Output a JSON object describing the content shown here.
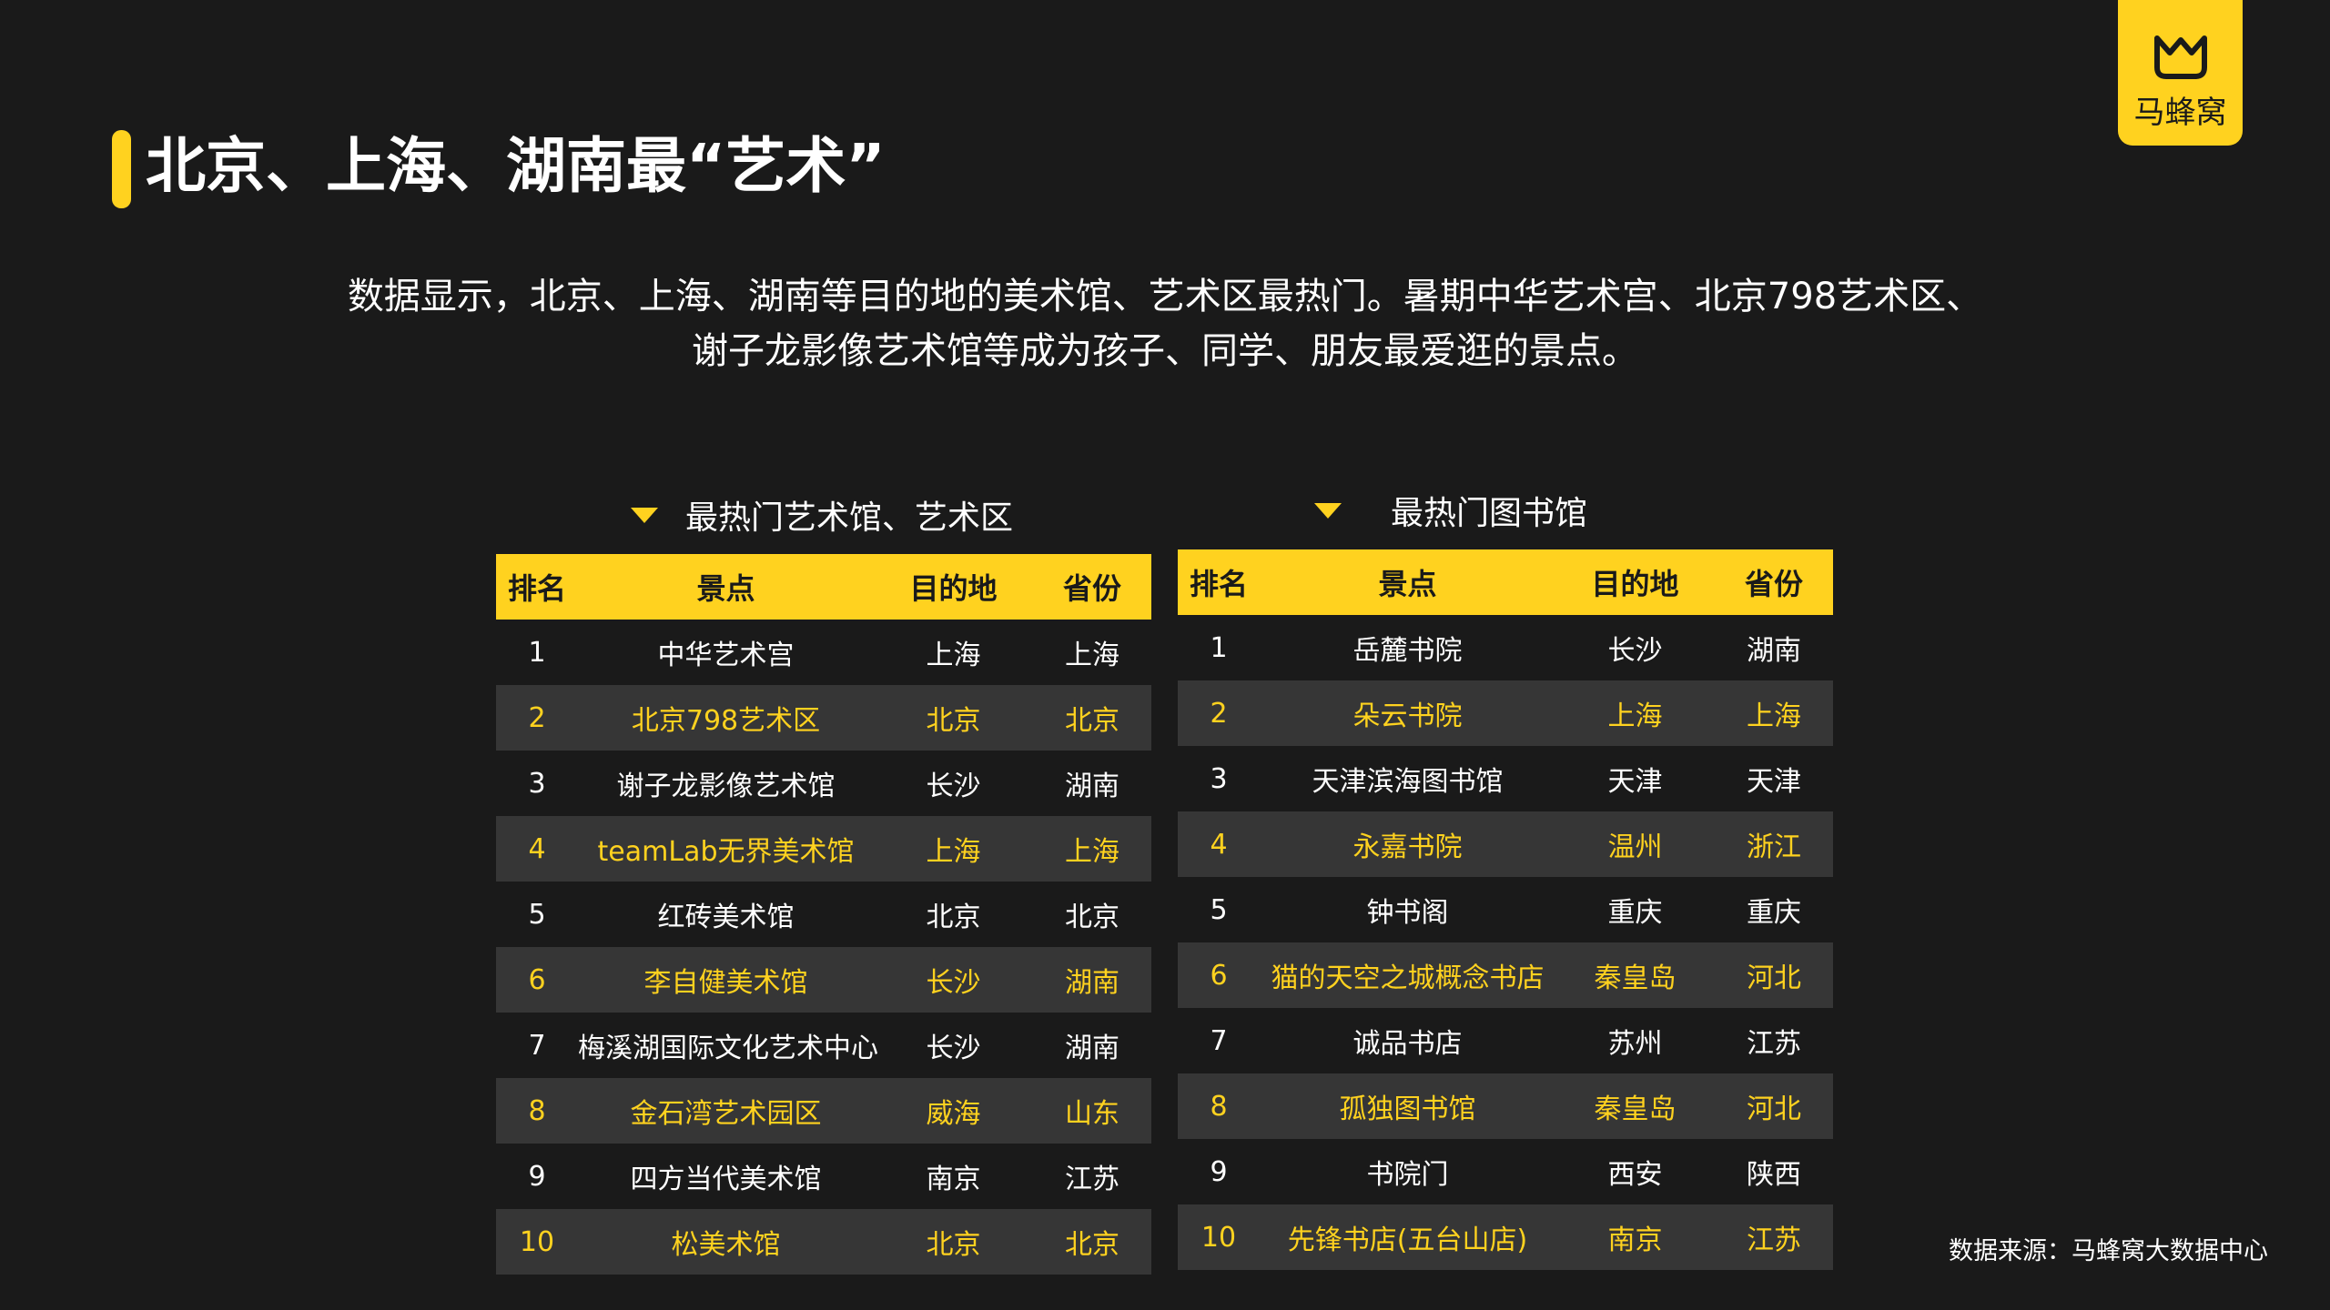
{
  "title": "北京、上海、湖南最“艺术”",
  "logo": {
    "text": "马蜂窝"
  },
  "summary": {
    "line1": "数据显示，北京、上海、湖南等目的地的美术馆、艺术区最热门。暑期中华艺术宫、北京798艺术区、",
    "line2": "谢子龙影像艺术馆等成为孩子、同学、朋友最爱逛的景点。"
  },
  "colors": {
    "accent": "#ffd21f",
    "background": "#1a1a1a",
    "alt_row": "#363636"
  },
  "tables": {
    "art": {
      "heading": "最热门艺术馆、艺术区",
      "headers": {
        "rank": "排名",
        "name": "景点",
        "destination": "目的地",
        "province": "省份"
      },
      "rows": [
        {
          "rank": "1",
          "name": "中华艺术宫",
          "destination": "上海",
          "province": "上海"
        },
        {
          "rank": "2",
          "name": "北京798艺术区",
          "destination": "北京",
          "province": "北京"
        },
        {
          "rank": "3",
          "name": "谢子龙影像艺术馆",
          "destination": "长沙",
          "province": "湖南"
        },
        {
          "rank": "4",
          "name": "teamLab无界美术馆",
          "destination": "上海",
          "province": "上海"
        },
        {
          "rank": "5",
          "name": "红砖美术馆",
          "destination": "北京",
          "province": "北京"
        },
        {
          "rank": "6",
          "name": "李自健美术馆",
          "destination": "长沙",
          "province": "湖南"
        },
        {
          "rank": "7",
          "name": "梅溪湖国际文化艺术中心",
          "destination": "长沙",
          "province": "湖南"
        },
        {
          "rank": "8",
          "name": "金石湾艺术园区",
          "destination": "威海",
          "province": "山东"
        },
        {
          "rank": "9",
          "name": "四方当代美术馆",
          "destination": "南京",
          "province": "江苏"
        },
        {
          "rank": "10",
          "name": "松美术馆",
          "destination": "北京",
          "province": "北京"
        }
      ]
    },
    "library": {
      "heading": "最热门图书馆",
      "headers": {
        "rank": "排名",
        "name": "景点",
        "destination": "目的地",
        "province": "省份"
      },
      "rows": [
        {
          "rank": "1",
          "name": "岳麓书院",
          "destination": "长沙",
          "province": "湖南"
        },
        {
          "rank": "2",
          "name": "朵云书院",
          "destination": "上海",
          "province": "上海"
        },
        {
          "rank": "3",
          "name": "天津滨海图书馆",
          "destination": "天津",
          "province": "天津"
        },
        {
          "rank": "4",
          "name": "永嘉书院",
          "destination": "温州",
          "province": "浙江"
        },
        {
          "rank": "5",
          "name": "钟书阁",
          "destination": "重庆",
          "province": "重庆"
        },
        {
          "rank": "6",
          "name": "猫的天空之城概念书店",
          "destination": "秦皇岛",
          "province": "河北"
        },
        {
          "rank": "7",
          "name": "诚品书店",
          "destination": "苏州",
          "province": "江苏"
        },
        {
          "rank": "8",
          "name": "孤独图书馆",
          "destination": "秦皇岛",
          "province": "河北"
        },
        {
          "rank": "9",
          "name": "书院门",
          "destination": "西安",
          "province": "陕西"
        },
        {
          "rank": "10",
          "name": "先锋书店(五台山店)",
          "destination": "南京",
          "province": "江苏"
        }
      ]
    }
  },
  "source": "数据来源：马蜂窝大数据中心"
}
